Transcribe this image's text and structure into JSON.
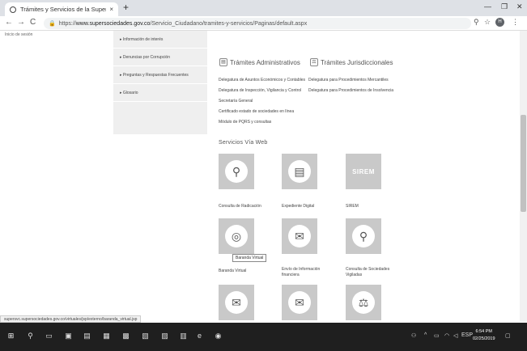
{
  "browser": {
    "tab_title": "Trámites y Servicios de la Supers",
    "tab_close": "×",
    "new_tab": "+",
    "url_prefix": "https://",
    "url_host": "www.supersociedades.gov.co",
    "url_path": "/Servicio_Ciudadano/tramites-y-servicios/Paginas/default.aspx",
    "profile_initial": "H",
    "status_url": "supersvc.supersociedades.gov.co/virtuales/jsp/externo/baranda_virtual.jsp"
  },
  "page": {
    "breadcrumb": "Inicio de sesión",
    "sidebar": [
      {
        "label": "▸ Información de interés"
      },
      {
        "label": "▸ Denuncias por Corrupción"
      },
      {
        "label": "▸ Preguntas y Respuestas Frecuentes"
      },
      {
        "label": "▸ Glosario"
      }
    ],
    "tramites_admin": {
      "title": "Trámites Administrativos",
      "links": [
        "Delegatura de Asuntos Económicos y Contables",
        "Delegatura de Inspección, Vigilancia y Control",
        "Secretaría General",
        "Certificado estado de sociedades en línea",
        "Módulo de PQRS y consultas"
      ]
    },
    "tramites_juris": {
      "title": "Trámites Jurisdiccionales",
      "links": [
        "Delegatura para Procedimientos Mercantiles",
        "Delegatura para Procedimientos de Insolvencia"
      ]
    },
    "services_heading": "Servicios Vía Web",
    "services": [
      {
        "label": "Consulta de Radicación",
        "icon": "magnifier-icon"
      },
      {
        "label": "Expediente Digital",
        "icon": "folder-icon"
      },
      {
        "label": "SIREM",
        "icon": "sirem-logo"
      },
      {
        "label": "Baranda Virtual",
        "icon": "globe-network-icon"
      },
      {
        "label": "Envío de Información financiera",
        "icon": "envelope-icon"
      },
      {
        "label": "Consulta de Sociedades Vigiladas",
        "icon": "search-circle-icon"
      },
      {
        "label": "",
        "icon": "envelope-fast-icon"
      },
      {
        "label": "",
        "icon": "mail-open-icon"
      },
      {
        "label": "",
        "icon": "scale-icon"
      }
    ],
    "tooltip": "Baranda Virtual"
  },
  "taskbar": {
    "lang": "ESP",
    "time": "6:54 PM",
    "date": "02/25/2019"
  }
}
